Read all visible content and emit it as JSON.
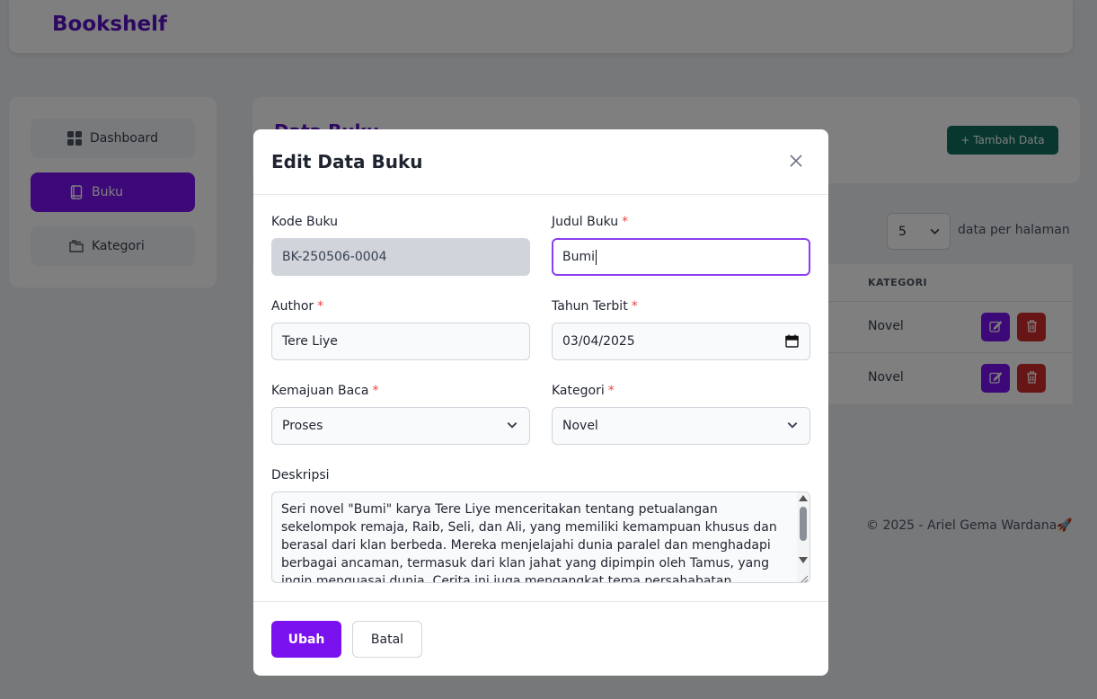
{
  "app": {
    "brand": "Bookshelf"
  },
  "sidebar": {
    "items": [
      {
        "label": "Dashboard",
        "icon": "grid-icon",
        "active": false
      },
      {
        "label": "Buku",
        "icon": "book-icon",
        "active": true
      },
      {
        "label": "Kategori",
        "icon": "folder-icon",
        "active": false
      }
    ]
  },
  "content": {
    "title": "Data Buku",
    "add_button": "+ Tambah Data",
    "pagination": {
      "per_page": "5",
      "label": "data per halaman"
    },
    "table": {
      "headers": {
        "kategori": "KATEGORI"
      },
      "rows": [
        {
          "kategori": "Novel"
        },
        {
          "kategori": "Novel"
        }
      ]
    },
    "footer": "© 2025 - Ariel Gema Wardana🚀"
  },
  "modal": {
    "title": "Edit Data Buku",
    "fields": {
      "kode_buku": {
        "label": "Kode Buku",
        "value": "BK-250506-0004"
      },
      "judul_buku": {
        "label": "Judul Buku",
        "required": "*",
        "value": "Bumi"
      },
      "author": {
        "label": "Author",
        "required": "*",
        "value": "Tere Liye"
      },
      "tahun_terbit": {
        "label": "Tahun Terbit",
        "required": "*",
        "value": "03/04/2025"
      },
      "kemajuan_baca": {
        "label": "Kemajuan Baca",
        "required": "*",
        "value": "Proses"
      },
      "kategori": {
        "label": "Kategori",
        "required": "*",
        "value": "Novel"
      },
      "deskripsi": {
        "label": "Deskripsi",
        "value": "Seri novel \"Bumi\" karya Tere Liye menceritakan tentang petualangan sekelompok remaja, Raib, Seli, dan Ali, yang memiliki kemampuan khusus dan berasal dari klan berbeda. Mereka menjelajahi dunia paralel dan menghadapi berbagai ancaman, termasuk dari klan jahat yang dipimpin oleh Tamus, yang ingin menguasai dunia. Cerita ini juga mengangkat tema persahabatan"
      }
    },
    "buttons": {
      "submit": "Ubah",
      "cancel": "Batal"
    }
  },
  "colors": {
    "brand": "#5b10c0",
    "accent": "#7a12f0",
    "danger": "#d02b2b",
    "success": "#0f6f5c",
    "required": "#ef4444"
  }
}
